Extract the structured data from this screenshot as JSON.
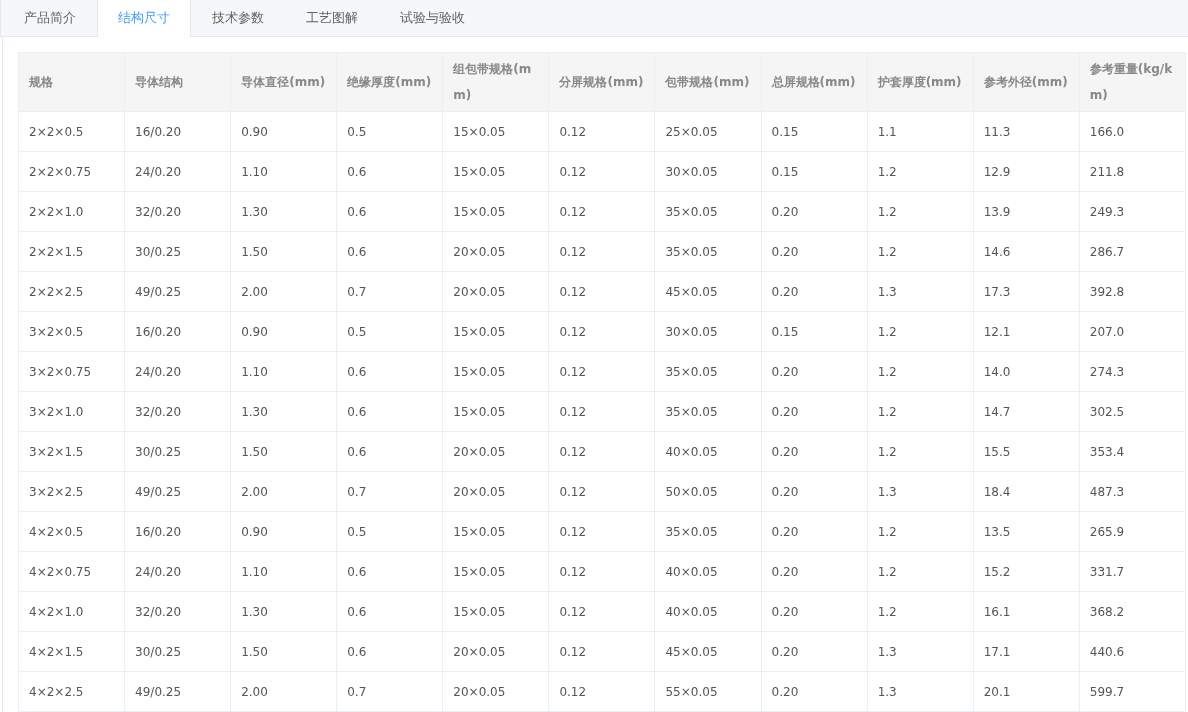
{
  "tabs": [
    {
      "label": "产品简介",
      "selected": false
    },
    {
      "label": "结构尺寸",
      "selected": true
    },
    {
      "label": "技术参数",
      "selected": false
    },
    {
      "label": "工艺图解",
      "selected": false
    },
    {
      "label": "试验与验收",
      "selected": false
    }
  ],
  "table": {
    "columns": [
      "规格",
      "导体结构",
      "导体直径(mm)",
      "绝缘厚度(mm)",
      "组包带规格(mm)",
      "分屏规格(mm)",
      "包带规格(mm)",
      "总屏规格(mm)",
      "护套厚度(mm)",
      "参考外径(mm)",
      "参考重量(kg/km)"
    ],
    "rows": [
      [
        "2×2×0.5",
        "16/0.20",
        "0.90",
        "0.5",
        "15×0.05",
        "0.12",
        "25×0.05",
        "0.15",
        "1.1",
        "11.3",
        "166.0"
      ],
      [
        "2×2×0.75",
        "24/0.20",
        "1.10",
        "0.6",
        "15×0.05",
        "0.12",
        "30×0.05",
        "0.15",
        "1.2",
        "12.9",
        "211.8"
      ],
      [
        "2×2×1.0",
        "32/0.20",
        "1.30",
        "0.6",
        "15×0.05",
        "0.12",
        "35×0.05",
        "0.20",
        "1.2",
        "13.9",
        "249.3"
      ],
      [
        "2×2×1.5",
        "30/0.25",
        "1.50",
        "0.6",
        "20×0.05",
        "0.12",
        "35×0.05",
        "0.20",
        "1.2",
        "14.6",
        "286.7"
      ],
      [
        "2×2×2.5",
        "49/0.25",
        "2.00",
        "0.7",
        "20×0.05",
        "0.12",
        "45×0.05",
        "0.20",
        "1.3",
        "17.3",
        "392.8"
      ],
      [
        "3×2×0.5",
        "16/0.20",
        "0.90",
        "0.5",
        "15×0.05",
        "0.12",
        "30×0.05",
        "0.15",
        "1.2",
        "12.1",
        "207.0"
      ],
      [
        "3×2×0.75",
        "24/0.20",
        "1.10",
        "0.6",
        "15×0.05",
        "0.12",
        "35×0.05",
        "0.20",
        "1.2",
        "14.0",
        "274.3"
      ],
      [
        "3×2×1.0",
        "32/0.20",
        "1.30",
        "0.6",
        "15×0.05",
        "0.12",
        "35×0.05",
        "0.20",
        "1.2",
        "14.7",
        "302.5"
      ],
      [
        "3×2×1.5",
        "30/0.25",
        "1.50",
        "0.6",
        "20×0.05",
        "0.12",
        "40×0.05",
        "0.20",
        "1.2",
        "15.5",
        "353.4"
      ],
      [
        "3×2×2.5",
        "49/0.25",
        "2.00",
        "0.7",
        "20×0.05",
        "0.12",
        "50×0.05",
        "0.20",
        "1.3",
        "18.4",
        "487.3"
      ],
      [
        "4×2×0.5",
        "16/0.20",
        "0.90",
        "0.5",
        "15×0.05",
        "0.12",
        "35×0.05",
        "0.20",
        "1.2",
        "13.5",
        "265.9"
      ],
      [
        "4×2×0.75",
        "24/0.20",
        "1.10",
        "0.6",
        "15×0.05",
        "0.12",
        "40×0.05",
        "0.20",
        "1.2",
        "15.2",
        "331.7"
      ],
      [
        "4×2×1.0",
        "32/0.20",
        "1.30",
        "0.6",
        "15×0.05",
        "0.12",
        "40×0.05",
        "0.20",
        "1.2",
        "16.1",
        "368.2"
      ],
      [
        "4×2×1.5",
        "30/0.25",
        "1.50",
        "0.6",
        "20×0.05",
        "0.12",
        "45×0.05",
        "0.20",
        "1.3",
        "17.1",
        "440.6"
      ],
      [
        "4×2×2.5",
        "49/0.25",
        "2.00",
        "0.7",
        "20×0.05",
        "0.12",
        "55×0.05",
        "0.20",
        "1.3",
        "20.1",
        "599.7"
      ]
    ]
  }
}
